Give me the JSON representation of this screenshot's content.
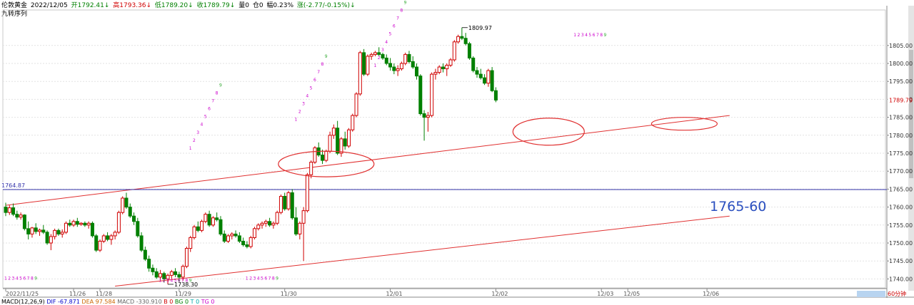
{
  "header": {
    "instrument": "伦敦黄金",
    "date": "2022/12/05",
    "open": "开1792.41↓",
    "high": "高1793.36↓",
    "low": "低1789.20↓",
    "close": "收1789.79↓",
    "volume": "量0",
    "position": "仓0",
    "amplitude": "幅0.23%",
    "change": "涨(-2.77/-0.15%)↓"
  },
  "subtitle": "九转序列",
  "macd_bar": {
    "name": "MACD(12,26,9)",
    "dif": "DIF -67.871",
    "dea": "DEA 97.584",
    "macd": "MACD -330.910",
    "b": "B 0",
    "bg": "BG 0",
    "t": "T 0",
    "tg": "TG 0"
  },
  "period_label": "60分钟",
  "annotation_text": "1765-60",
  "colors": {
    "up": "#d00000",
    "down": "#008000",
    "seq_up": "#cc00cc",
    "seq_nine": "#33aa33",
    "hline": "#3333aa",
    "trend": "#e03030",
    "price_tag": "#d00000"
  },
  "chart_data": {
    "type": "candlestick",
    "ylim": [
      1737.5,
      1812.5
    ],
    "y_ticks": [
      1740,
      1745,
      1750,
      1755,
      1760,
      1765,
      1770,
      1775,
      1780,
      1785,
      1790,
      1795,
      1800,
      1805
    ],
    "y_tick_labels": [
      "1740.00",
      "1745.00",
      "1750.00",
      "1755.00",
      "1760.00",
      "1765.00",
      "1770.00",
      "1775.00",
      "1780.00",
      "1785.00",
      "1790.00",
      "1795.00",
      "1800.00",
      "1805.00"
    ],
    "x_labels": [
      {
        "label": "2022/11/25",
        "index": 0
      },
      {
        "label": "11/26",
        "index": 18
      },
      {
        "label": "11/28",
        "index": 25
      },
      {
        "label": "11/29",
        "index": 46
      },
      {
        "label": "11/30",
        "index": 74
      },
      {
        "label": "12/01",
        "index": 102
      },
      {
        "label": "12/02",
        "index": 130
      },
      {
        "label": "12/03",
        "index": 158
      },
      {
        "label": "12/05",
        "index": 165
      },
      {
        "label": "12/06",
        "index": 186
      }
    ],
    "candles": [
      [
        1760.0,
        1761.2,
        1757.5,
        1758.5
      ],
      [
        1758.5,
        1760.5,
        1757.8,
        1759.8
      ],
      [
        1759.8,
        1761.0,
        1757.5,
        1758.0
      ],
      [
        1758.0,
        1759.0,
        1756.5,
        1757.2
      ],
      [
        1757.2,
        1758.5,
        1756.5,
        1757.8
      ],
      [
        1757.8,
        1758.0,
        1753.5,
        1754.0
      ],
      [
        1754.0,
        1756.0,
        1751.0,
        1752.5
      ],
      [
        1752.5,
        1754.5,
        1751.5,
        1754.2
      ],
      [
        1754.2,
        1755.5,
        1752.5,
        1753.2
      ],
      [
        1753.2,
        1754.0,
        1752.0,
        1753.6
      ],
      [
        1753.6,
        1755.0,
        1752.5,
        1753.0
      ],
      [
        1753.0,
        1753.5,
        1749.5,
        1750.0
      ],
      [
        1750.0,
        1752.5,
        1748.0,
        1751.8
      ],
      [
        1751.8,
        1754.0,
        1751.0,
        1753.5
      ],
      [
        1753.5,
        1754.0,
        1752.0,
        1752.5
      ],
      [
        1752.5,
        1753.8,
        1751.5,
        1753.0
      ],
      [
        1753.0,
        1756.0,
        1752.5,
        1755.5
      ],
      [
        1755.5,
        1756.5,
        1754.5,
        1755.0
      ],
      [
        1755.0,
        1756.5,
        1754.5,
        1756.0
      ],
      [
        1756.0,
        1757.0,
        1754.5,
        1755.2
      ],
      [
        1755.2,
        1755.8,
        1754.8,
        1755.5
      ],
      [
        1755.5,
        1756.0,
        1754.5,
        1755.0
      ],
      [
        1755.0,
        1756.0,
        1754.0,
        1755.5
      ],
      [
        1755.5,
        1756.0,
        1751.5,
        1752.0
      ],
      [
        1752.0,
        1752.5,
        1747.5,
        1748.0
      ],
      [
        1748.0,
        1751.0,
        1747.5,
        1750.5
      ],
      [
        1750.5,
        1752.5,
        1750.0,
        1752.0
      ],
      [
        1752.0,
        1753.0,
        1750.5,
        1751.0
      ],
      [
        1751.0,
        1752.5,
        1749.5,
        1752.0
      ],
      [
        1752.0,
        1753.5,
        1751.0,
        1753.0
      ],
      [
        1753.0,
        1759.0,
        1752.5,
        1758.5
      ],
      [
        1758.5,
        1763.0,
        1758.0,
        1762.5
      ],
      [
        1762.5,
        1764.0,
        1759.5,
        1760.0
      ],
      [
        1760.0,
        1761.0,
        1757.0,
        1757.5
      ],
      [
        1757.5,
        1758.5,
        1755.0,
        1756.0
      ],
      [
        1756.0,
        1757.0,
        1751.5,
        1752.0
      ],
      [
        1752.0,
        1753.0,
        1747.5,
        1748.0
      ],
      [
        1748.0,
        1749.0,
        1745.0,
        1745.5
      ],
      [
        1745.5,
        1746.5,
        1742.0,
        1743.0
      ],
      [
        1743.0,
        1744.0,
        1741.0,
        1742.0
      ],
      [
        1742.0,
        1743.0,
        1740.0,
        1740.5
      ],
      [
        1740.5,
        1742.5,
        1739.5,
        1741.5
      ],
      [
        1741.5,
        1742.0,
        1739.0,
        1740.0
      ],
      [
        1740.0,
        1741.5,
        1738.5,
        1741.0
      ],
      [
        1741.0,
        1742.5,
        1740.0,
        1742.0
      ],
      [
        1742.0,
        1743.0,
        1740.5,
        1741.2
      ],
      [
        1741.2,
        1742.0,
        1739.2,
        1740.5
      ],
      [
        1740.5,
        1744.0,
        1739.5,
        1743.5
      ],
      [
        1743.5,
        1749.0,
        1743.0,
        1748.5
      ],
      [
        1748.5,
        1752.0,
        1747.5,
        1751.5
      ],
      [
        1751.5,
        1755.0,
        1751.0,
        1754.5
      ],
      [
        1754.5,
        1756.0,
        1753.0,
        1753.5
      ],
      [
        1753.5,
        1756.5,
        1753.0,
        1756.0
      ],
      [
        1756.0,
        1758.5,
        1755.5,
        1758.0
      ],
      [
        1758.0,
        1759.0,
        1754.5,
        1755.0
      ],
      [
        1755.0,
        1757.5,
        1754.5,
        1757.0
      ],
      [
        1757.0,
        1758.5,
        1756.0,
        1756.5
      ],
      [
        1756.5,
        1757.5,
        1752.0,
        1752.5
      ],
      [
        1752.5,
        1753.5,
        1750.0,
        1750.5
      ],
      [
        1750.5,
        1752.5,
        1750.0,
        1752.0
      ],
      [
        1752.0,
        1753.0,
        1751.0,
        1752.5
      ],
      [
        1752.5,
        1753.5,
        1751.5,
        1752.0
      ],
      [
        1752.0,
        1753.0,
        1750.0,
        1750.5
      ],
      [
        1750.5,
        1751.5,
        1749.0,
        1749.5
      ],
      [
        1749.5,
        1750.5,
        1748.5,
        1749.0
      ],
      [
        1749.0,
        1752.0,
        1748.5,
        1751.5
      ],
      [
        1751.5,
        1754.5,
        1751.0,
        1754.0
      ],
      [
        1754.0,
        1755.5,
        1753.5,
        1755.0
      ],
      [
        1755.0,
        1756.0,
        1754.0,
        1755.5
      ],
      [
        1755.5,
        1756.5,
        1754.5,
        1756.0
      ],
      [
        1756.0,
        1757.0,
        1754.5,
        1755.0
      ],
      [
        1755.0,
        1756.0,
        1754.0,
        1755.5
      ],
      [
        1755.5,
        1759.0,
        1755.0,
        1758.5
      ],
      [
        1758.5,
        1763.5,
        1758.0,
        1763.0
      ],
      [
        1763.0,
        1764.0,
        1759.0,
        1759.5
      ],
      [
        1759.5,
        1764.5,
        1759.0,
        1764.0
      ],
      [
        1764.0,
        1765.0,
        1756.5,
        1757.0
      ],
      [
        1757.0,
        1760.0,
        1752.0,
        1752.5
      ],
      [
        1752.5,
        1756.0,
        1751.0,
        1755.5
      ],
      [
        1755.5,
        1760.0,
        1745.0,
        1759.0
      ],
      [
        1759.0,
        1769.5,
        1758.5,
        1769.0
      ],
      [
        1769.0,
        1773.0,
        1768.0,
        1772.5
      ],
      [
        1772.5,
        1777.0,
        1772.0,
        1776.5
      ],
      [
        1776.5,
        1778.0,
        1774.0,
        1774.5
      ],
      [
        1774.5,
        1776.0,
        1772.0,
        1773.0
      ],
      [
        1773.0,
        1776.0,
        1772.5,
        1775.5
      ],
      [
        1775.5,
        1781.0,
        1775.0,
        1780.0
      ],
      [
        1780.0,
        1783.0,
        1779.0,
        1782.0
      ],
      [
        1782.0,
        1784.0,
        1774.5,
        1775.0
      ],
      [
        1775.0,
        1779.5,
        1774.0,
        1779.0
      ],
      [
        1779.0,
        1781.0,
        1776.0,
        1777.0
      ],
      [
        1777.0,
        1782.0,
        1776.5,
        1781.5
      ],
      [
        1781.5,
        1786.0,
        1781.0,
        1785.5
      ],
      [
        1785.5,
        1792.0,
        1785.0,
        1791.5
      ],
      [
        1791.5,
        1803.5,
        1791.0,
        1803.0
      ],
      [
        1803.0,
        1804.0,
        1796.5,
        1797.0
      ],
      [
        1797.0,
        1802.5,
        1796.5,
        1802.0
      ],
      [
        1802.0,
        1803.0,
        1801.0,
        1802.5
      ],
      [
        1802.5,
        1803.5,
        1802.0,
        1803.0
      ],
      [
        1803.0,
        1804.5,
        1802.0,
        1802.5
      ],
      [
        1802.5,
        1803.0,
        1801.0,
        1801.5
      ],
      [
        1801.5,
        1802.5,
        1799.5,
        1800.0
      ],
      [
        1800.0,
        1801.5,
        1798.0,
        1799.0
      ],
      [
        1799.0,
        1800.0,
        1797.0,
        1798.0
      ],
      [
        1798.0,
        1799.5,
        1796.5,
        1798.5
      ],
      [
        1798.5,
        1800.5,
        1798.0,
        1800.0
      ],
      [
        1800.0,
        1803.0,
        1799.5,
        1802.5
      ],
      [
        1802.5,
        1803.5,
        1800.0,
        1800.5
      ],
      [
        1800.5,
        1802.0,
        1798.5,
        1799.0
      ],
      [
        1799.0,
        1800.0,
        1795.5,
        1796.5
      ],
      [
        1796.5,
        1797.0,
        1785.5,
        1786.0
      ],
      [
        1786.0,
        1787.0,
        1778.5,
        1785.0
      ],
      [
        1785.0,
        1786.5,
        1781.0,
        1785.5
      ],
      [
        1785.5,
        1797.5,
        1785.0,
        1797.0
      ],
      [
        1797.0,
        1798.5,
        1795.5,
        1797.5
      ],
      [
        1797.5,
        1799.5,
        1797.0,
        1799.0
      ],
      [
        1799.0,
        1800.0,
        1797.5,
        1798.5
      ],
      [
        1798.5,
        1800.0,
        1796.5,
        1799.5
      ],
      [
        1799.5,
        1801.5,
        1799.0,
        1801.0
      ],
      [
        1801.0,
        1806.5,
        1800.5,
        1806.0
      ],
      [
        1806.0,
        1808.0,
        1805.5,
        1807.5
      ],
      [
        1807.5,
        1809.97,
        1806.5,
        1807.0
      ],
      [
        1807.0,
        1808.5,
        1805.0,
        1805.5
      ],
      [
        1805.5,
        1806.0,
        1801.0,
        1801.5
      ],
      [
        1801.5,
        1802.0,
        1797.5,
        1798.0
      ],
      [
        1798.0,
        1799.0,
        1796.0,
        1797.0
      ],
      [
        1797.0,
        1798.5,
        1795.5,
        1796.0
      ],
      [
        1796.0,
        1797.0,
        1794.0,
        1794.5
      ],
      [
        1794.5,
        1798.5,
        1793.5,
        1798.0
      ],
      [
        1798.0,
        1799.0,
        1792.0,
        1792.41
      ],
      [
        1792.41,
        1793.36,
        1789.2,
        1789.79
      ]
    ],
    "nine_sequence": [
      {
        "start": 0,
        "count": 9,
        "price": 1739.8,
        "type": "low"
      },
      {
        "start": 41,
        "count": 9,
        "price": 1739.2,
        "type": "low"
      },
      {
        "start": 64,
        "count": 9,
        "price": 1739.8,
        "type": "low"
      },
      {
        "start": 49,
        "count": 9,
        "price": 1776,
        "type": "rise"
      },
      {
        "start": 77,
        "count": 9,
        "price": 1784,
        "type": "rise"
      },
      {
        "start": 98,
        "count": 9,
        "price": 1799,
        "type": "rise"
      },
      {
        "start": 151,
        "count": 9,
        "price": 1807.5,
        "type": "top"
      }
    ],
    "annotations": {
      "high_label": "1809.97",
      "low_label": "1738.30",
      "hline_label": "1764.87",
      "hline_value": 1764.87,
      "last_price_label": "1789.79",
      "last_price": 1789.79
    },
    "trend_lines": [
      {
        "x1": 0,
        "y1": 1760.5,
        "x2": 192,
        "y2": 1785.5
      },
      {
        "x1": 29,
        "y1": 1738.0,
        "x2": 192,
        "y2": 1757.5
      }
    ],
    "ellipses": [
      {
        "cx": 85,
        "cy": 1772.0
      },
      {
        "cx": 144,
        "cy": 1781.0
      },
      {
        "cx": 180,
        "cy": 1783.2
      }
    ]
  }
}
